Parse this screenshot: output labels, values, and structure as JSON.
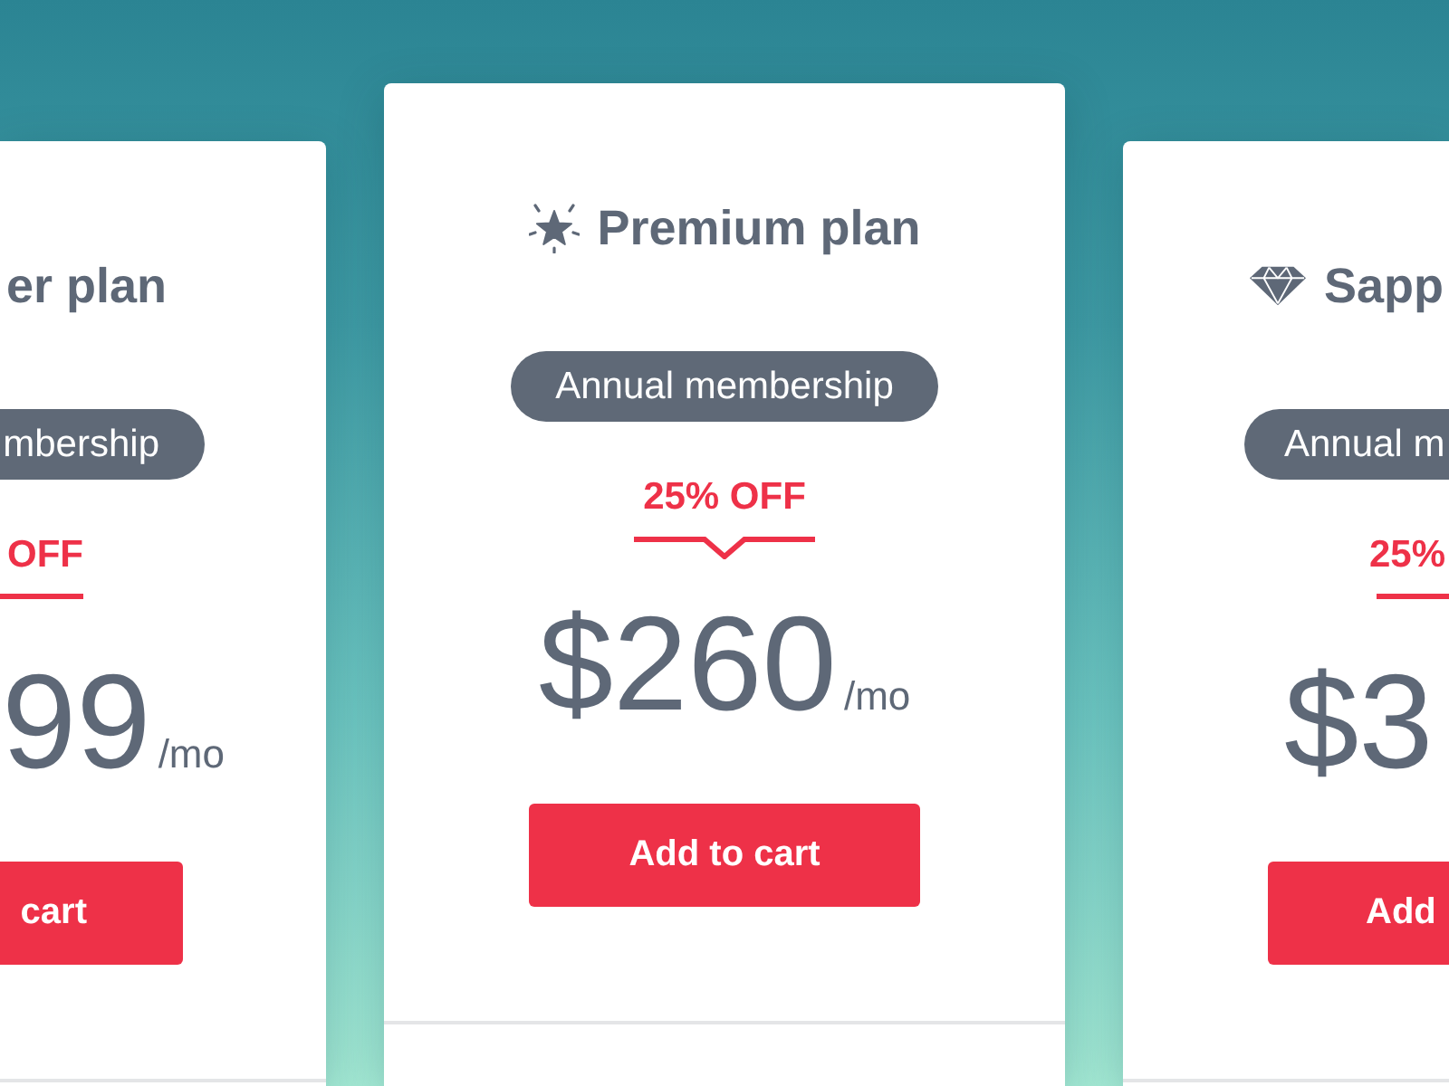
{
  "plans": [
    {
      "featured": false,
      "title": "er plan",
      "badge": "mbership",
      "discount": "OFF",
      "price": "99",
      "period": "/mo",
      "button": "cart"
    },
    {
      "featured": true,
      "title": "Premium plan",
      "badge": "Annual membership",
      "discount": "25% OFF",
      "price": "$260",
      "period": "/mo",
      "button": "Add to cart"
    },
    {
      "featured": false,
      "title": "Sapp",
      "badge": "Annual m",
      "discount": "25%",
      "price": "$3",
      "button": "Add"
    }
  ]
}
